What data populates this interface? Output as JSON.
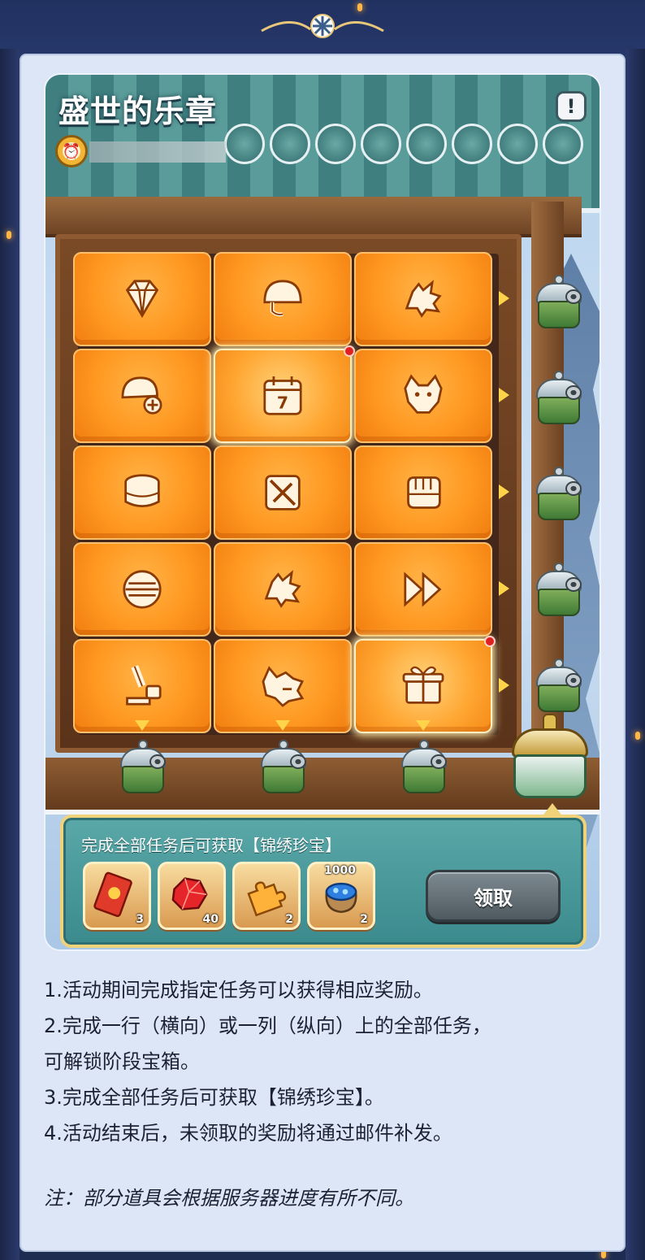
{
  "event": {
    "title": "盛世的乐章",
    "info_icon": "exclamation-icon",
    "clock_icon": "clock-icon"
  },
  "grid": {
    "rows": [
      [
        {
          "icon": "diamond-icon",
          "active": false,
          "red_dot": false
        },
        {
          "icon": "helmet-icon",
          "active": false,
          "red_dot": false
        },
        {
          "icon": "dragon-head-icon",
          "active": false,
          "red_dot": false
        }
      ],
      [
        {
          "icon": "helmet-plus-icon",
          "active": false,
          "red_dot": false
        },
        {
          "icon": "calendar-7-icon",
          "active": true,
          "red_dot": true
        },
        {
          "icon": "wolf-head-icon",
          "active": false,
          "red_dot": false
        }
      ],
      [
        {
          "icon": "tin-can-icon",
          "active": false,
          "red_dot": false
        },
        {
          "icon": "no-sword-icon",
          "active": false,
          "red_dot": false
        },
        {
          "icon": "fist-icon",
          "active": false,
          "red_dot": false
        }
      ],
      [
        {
          "icon": "coin-stack-icon",
          "active": false,
          "red_dot": false
        },
        {
          "icon": "dragon-head-icon",
          "active": false,
          "red_dot": false
        },
        {
          "icon": "fast-forward-icon",
          "active": false,
          "red_dot": false
        }
      ],
      [
        {
          "icon": "microscope-icon",
          "active": false,
          "red_dot": false
        },
        {
          "icon": "wolf-roar-icon",
          "active": false,
          "red_dot": false
        },
        {
          "icon": "gift-box-icon",
          "active": true,
          "red_dot": true
        }
      ]
    ]
  },
  "reward": {
    "text": "完成全部任务后可获取【锦绣珍宝】",
    "items": [
      {
        "icon": "ticket-icon",
        "qty": "3",
        "top": ""
      },
      {
        "icon": "red-crystal-icon",
        "qty": "40",
        "top": ""
      },
      {
        "icon": "puzzle-piece-icon",
        "qty": "2",
        "top": ""
      },
      {
        "icon": "gem-bag-icon",
        "qty": "2",
        "top": "1000"
      }
    ],
    "claim_label": "领取"
  },
  "rules": [
    "1.活动期间完成指定任务可以获得相应奖励。",
    "2.完成一行（横向）或一列（纵向）上的全部任务，",
    "可解锁阶段宝箱。",
    "3.完成全部任务后可获取【锦绣珍宝】。",
    "4.活动结束后，未领取的奖励将通过邮件补发。"
  ],
  "note": "注：部分道具会根据服务器进度有所不同。",
  "colors": {
    "tile_orange": "#ff9820",
    "reward_teal": "#4b9a9b",
    "arrow_yellow": "#ffd34a",
    "red_dot": "#e02020"
  }
}
